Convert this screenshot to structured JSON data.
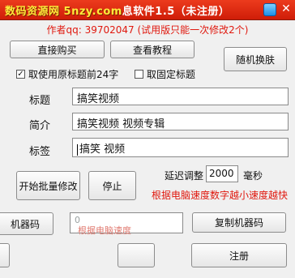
{
  "window": {
    "title_watermark": "数码资源网 5nzy.com",
    "title_rest": "息软件1.5（未注册）",
    "skin_icon": "tshirt-icon",
    "close_glyph": "✕"
  },
  "author_line": "作者qq: 39702047 (试用版只能一次修改2个)",
  "buttons": {
    "buy": "直接购买",
    "tutorial": "查看教程",
    "random_skin": "随机换肤",
    "batch_modify": "开始批量修改",
    "stop": "停止",
    "copy_machine_code": "复制机器码",
    "register": "注册"
  },
  "checkboxes": {
    "take_title_first": {
      "label": "取使用原标题前24字",
      "checked": true
    },
    "fixed_title": {
      "label": "取固定标题",
      "checked": false
    }
  },
  "fields": {
    "title": {
      "label": "标题",
      "value": "搞笑视频"
    },
    "intro": {
      "label": "简介",
      "value": "搞笑视频  视频专辑"
    },
    "tags": {
      "label": "标签",
      "value": "搞笑 视频"
    }
  },
  "delay": {
    "label": "延迟调整",
    "value": "2000",
    "unit": "毫秒"
  },
  "speed_hint": "根据电脑速度数字越小速度越快",
  "machine_code": {
    "label": "机器码",
    "value": "0",
    "ghost_hint": "根据电脑速度"
  }
}
